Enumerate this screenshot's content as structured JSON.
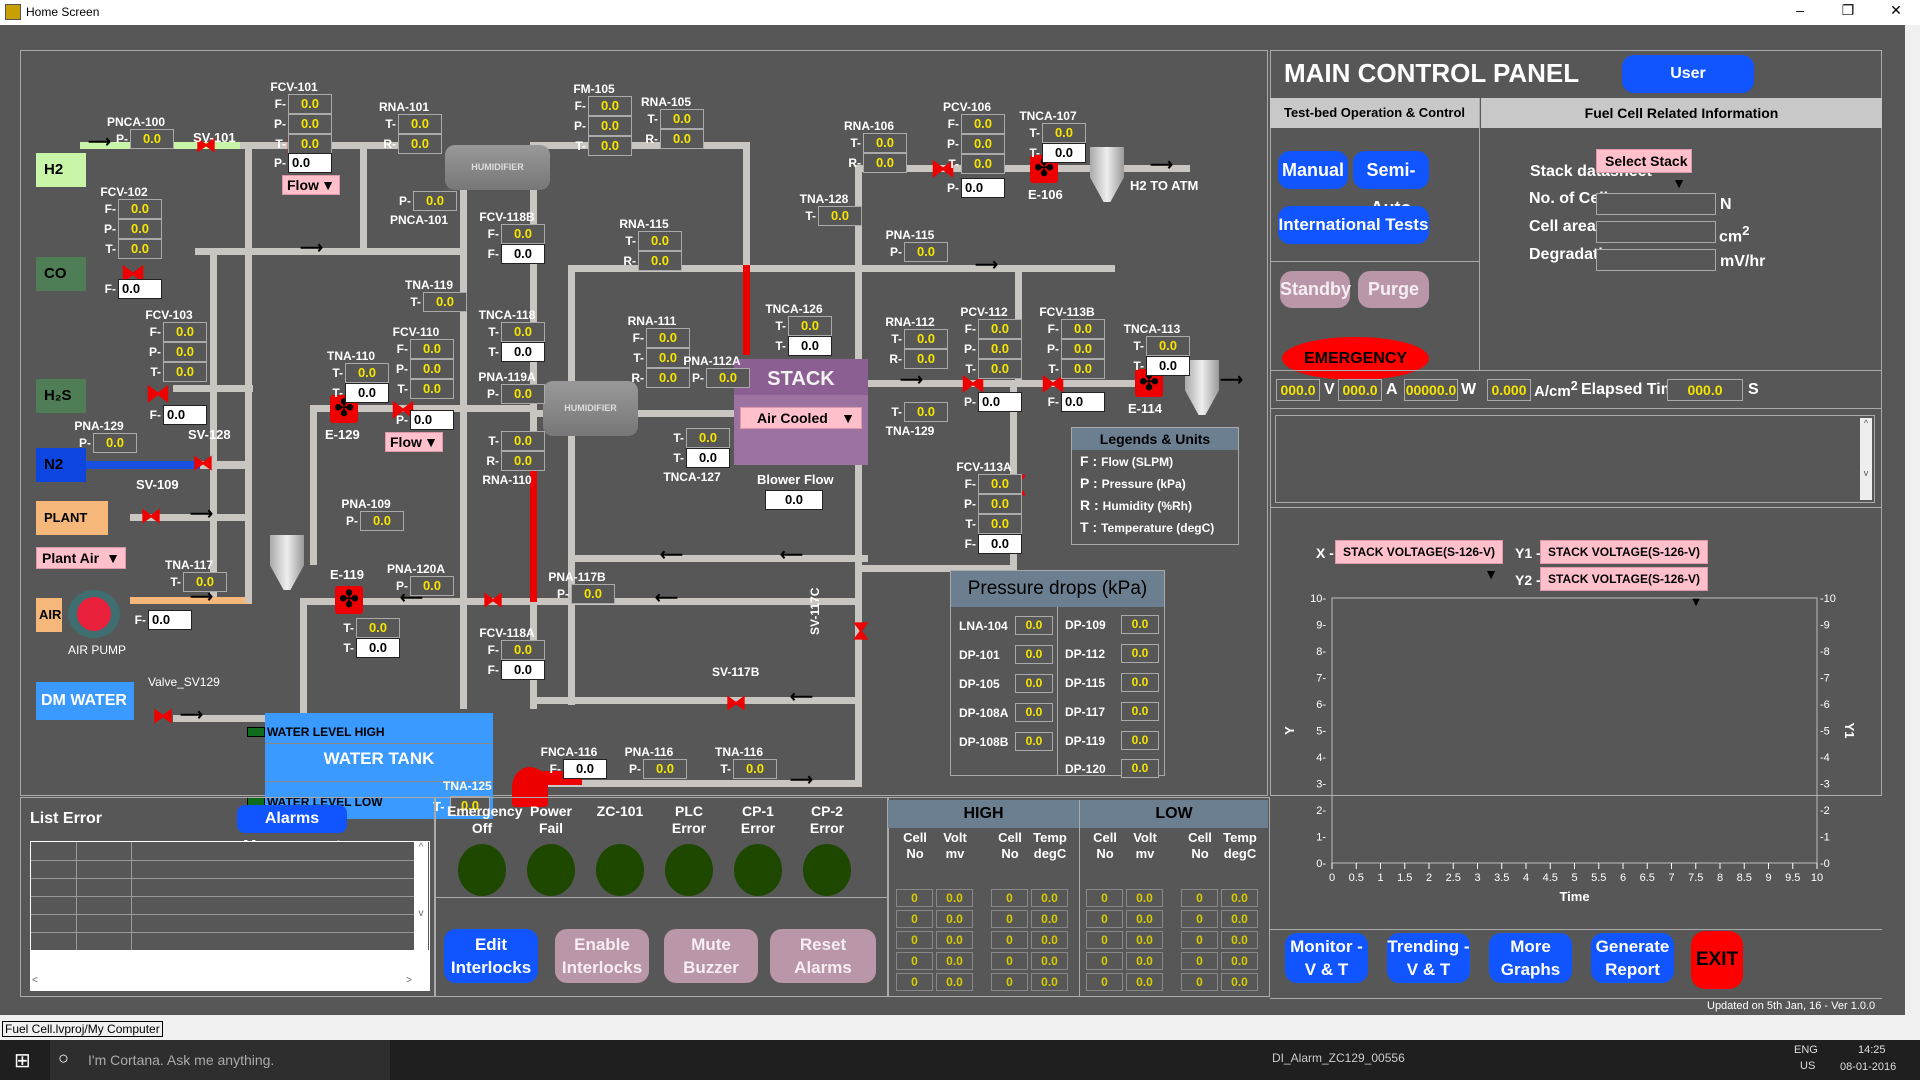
{
  "window": {
    "title": "Home Screen",
    "minimize": "–",
    "restore": "❐",
    "close": "✕"
  },
  "statusbar": {
    "path": "Fuel Cell.lvproj/My Computer"
  },
  "taskbar": {
    "search_placeholder": "I'm Cortana. Ask me anything.",
    "lang": "ENG",
    "region": "US",
    "time": "14:25",
    "date": "08-01-2016",
    "task_text": "DI_Alarm_ZC129_00556"
  },
  "sources": {
    "h2": "H2",
    "co": "CO",
    "h2s": "H₂S",
    "n2": "N2",
    "plant_air": "PLANT AIR",
    "air": "AIR",
    "air_pump": "AIR PUMP",
    "dm_water": "DM WATER",
    "plant_air_select": "Plant Air",
    "h2_to_atm": "H2  TO ATM"
  },
  "instruments": {
    "pnca100": {
      "name": "PNCA-100",
      "P": "0.0"
    },
    "sv101": "SV-101",
    "fcv101": {
      "name": "FCV-101",
      "F": "0.0",
      "P": "0.0",
      "T": "0.0",
      "P_set": "0.0",
      "mode": "Flow"
    },
    "rna101": {
      "name": "RNA-101",
      "T": "0.0",
      "R": "0.0"
    },
    "pnca101": {
      "name": "PNCA-101",
      "P": "0.0"
    },
    "fcv102": {
      "name": "FCV-102",
      "F": "0.0",
      "P": "0.0",
      "T": "0.0",
      "F_set": "0.0"
    },
    "fcv103": {
      "name": "FCV-103",
      "F": "0.0",
      "P": "0.0",
      "T": "0.0",
      "F_set": "0.0"
    },
    "pna129": {
      "name": "PNA-129",
      "P": "0.0"
    },
    "sv128": "SV-128",
    "sv109": "SV-109",
    "tna117": {
      "name": "TNA-117",
      "T": "0.0"
    },
    "air_f": {
      "F": "0.0"
    },
    "valve_sv129": "Valve_SV129",
    "fm105": {
      "name": "FM-105",
      "F": "0.0",
      "P": "0.0",
      "T": "0.0"
    },
    "rna105": {
      "name": "RNA-105",
      "T": "0.0",
      "R": "0.0"
    },
    "humidifier1": "HUMIDIFIER",
    "humidifier2": "HUMIDIFIER",
    "fcv118b": {
      "name": "FCV-118B",
      "F": "0.0",
      "F_set": "0.0"
    },
    "tna119": {
      "name": "TNA-119",
      "T": "0.0"
    },
    "tnca118": {
      "name": "TNCA-118",
      "T": "0.0",
      "T_set": "0.0"
    },
    "pna119a": {
      "name": "PNA-119A",
      "P": "0.0"
    },
    "rna110": {
      "name": "RNA-110",
      "T": "0.0",
      "R": "0.0"
    },
    "tna110": {
      "name": "TNA-110",
      "T": "0.0",
      "T_set": "0.0"
    },
    "e129": "E-129",
    "fcv110": {
      "name": "FCV-110",
      "F": "0.0",
      "P": "0.0",
      "T": "0.0",
      "P_set": "0.0",
      "mode": "Flow"
    },
    "pna109": {
      "name": "PNA-109",
      "P": "0.0"
    },
    "e119": {
      "name": "E-119",
      "T": "0.0",
      "T_set": "0.0"
    },
    "pna120a": {
      "name": "PNA-120A",
      "P": "0.0"
    },
    "fcv118a": {
      "name": "FCV-118A",
      "F": "0.0",
      "F_set": "0.0"
    },
    "rna115": {
      "name": "RNA-115",
      "T": "0.0",
      "R": "0.0"
    },
    "rna111": {
      "name": "RNA-111",
      "F": "0.0",
      "T": "0.0",
      "R": "0.0"
    },
    "pna112a": {
      "name": "PNA-112A",
      "P": "0.0"
    },
    "tnca127": {
      "name": "TNCA-127",
      "T": "0.0",
      "T_set": "0.0"
    },
    "tnca126": {
      "name": "TNCA-126",
      "T": "0.0",
      "T_set": "0.0"
    },
    "stack": {
      "title": "STACK",
      "cooling": "Air Cooled",
      "blower_label": "Blower Flow",
      "blower": "0.0"
    },
    "pna117b": {
      "name": "PNA-117B",
      "P": "0.0"
    },
    "rna106": {
      "name": "RNA-106",
      "T": "0.0",
      "R": "0.0"
    },
    "tna128": {
      "name": "TNA-128",
      "T": "0.0"
    },
    "pcv106": {
      "name": "PCV-106",
      "F": "0.0",
      "P": "0.0",
      "T": "0.0",
      "P_set": "0.0"
    },
    "tnca107": {
      "name": "TNCA-107",
      "T": "0.0",
      "T_set": "0.0"
    },
    "e106": "E-106",
    "pna115": {
      "name": "PNA-115",
      "P": "0.0"
    },
    "rna112": {
      "name": "RNA-112",
      "T": "0.0",
      "R": "0.0"
    },
    "tna129": {
      "name": "TNA-129",
      "T": "0.0"
    },
    "pcv112": {
      "name": "PCV-112",
      "F": "0.0",
      "P": "0.0",
      "T": "0.0",
      "P_set": "0.0"
    },
    "fcv113b": {
      "name": "FCV-113B",
      "F": "0.0",
      "P": "0.0",
      "T": "0.0",
      "F_set": "0.0"
    },
    "tnca113": {
      "name": "TNCA-113",
      "T": "0.0",
      "T_set": "0.0"
    },
    "e114": "E-114",
    "fcv113a": {
      "name": "FCV-113A",
      "F": "0.0",
      "P": "0.0",
      "T": "0.0",
      "F_set": "0.0"
    },
    "sv117c": "SV-117C",
    "sv117b": "SV-117B",
    "fnca116": {
      "name": "FNCA-116",
      "F": "0.0"
    },
    "pna116": {
      "name": "PNA-116",
      "P": "0.0"
    },
    "tna116": {
      "name": "TNA-116",
      "T": "0.0"
    },
    "tna125": {
      "name": "TNA-125",
      "T": "0.0"
    },
    "water_tank": {
      "title": "WATER  TANK",
      "level_high": "WATER LEVEL HIGH",
      "level_low": "WATER LEVEL LOW"
    }
  },
  "legend": {
    "title": "Legends & Units",
    "items": [
      {
        "key": "F :",
        "text": "Flow (SLPM)"
      },
      {
        "key": "P :",
        "text": "Pressure (kPa)"
      },
      {
        "key": "R :",
        "text": "Humidity (%Rh)"
      },
      {
        "key": "T :",
        "text": "Temperature (degC)"
      }
    ]
  },
  "pressure_drops": {
    "title": "Pressure drops (kPa)",
    "left": [
      {
        "name": "LNA-104",
        "value": "0.0"
      },
      {
        "name": "DP-101",
        "value": "0.0"
      },
      {
        "name": "DP-105",
        "value": "0.0"
      },
      {
        "name": "DP-108A",
        "value": "0.0"
      },
      {
        "name": "DP-108B",
        "value": "0.0"
      }
    ],
    "right": [
      {
        "name": "DP-109",
        "value": "0.0"
      },
      {
        "name": "DP-112",
        "value": "0.0"
      },
      {
        "name": "DP-115",
        "value": "0.0"
      },
      {
        "name": "DP-117",
        "value": "0.0"
      },
      {
        "name": "DP-119",
        "value": "0.0"
      },
      {
        "name": "DP-120",
        "value": "0.0"
      }
    ]
  },
  "control_panel": {
    "title": "MAIN CONTROL PANEL",
    "user_mgmt": "User Management",
    "testbed_header": "Test-bed Operation & Control",
    "info_header": "Fuel Cell Related Information",
    "manual": "Manual",
    "semi_auto": "Semi-Auto",
    "intl_tests": "International Tests",
    "standby": "Standby",
    "purge": "Purge",
    "emergency": "EMERGENCY",
    "stack_datasheet": "Stack datasheet",
    "select_stack": "Select Stack",
    "num_cells": "No. of Cells",
    "num_cells_unit": "N",
    "num_cells_value": "",
    "cell_area": "Cell area",
    "cell_area_unit": "cm",
    "cell_area_sup": "2",
    "cell_area_value": "",
    "degradation": "Degradation",
    "degradation_unit": "mV/hr",
    "degradation_value": ""
  },
  "readouts": {
    "volt": "000.0",
    "volt_unit": "V",
    "amp": "000.0",
    "amp_unit": "A",
    "watt": "00000.0",
    "watt_unit": "W",
    "density": "0.000",
    "density_unit": "A/cm",
    "density_sup": "2",
    "elapsed_label": "Elapsed Time",
    "elapsed": "000.0",
    "elapsed_unit": "S"
  },
  "message_box": {
    "text": ""
  },
  "graph_selectors": {
    "x_label": "X -",
    "x": "STACK VOLTAGE(S-126-V)",
    "y1_label": "Y1 -",
    "y1": "STACK VOLTAGE(S-126-V)",
    "y2_label": "Y2 -",
    "y2": "STACK VOLTAGE(S-126-V)"
  },
  "chart_data": {
    "type": "line",
    "title": "",
    "xlabel": "Time",
    "ylabel": "Y",
    "y2label": "Y1",
    "xlim": [
      0,
      10
    ],
    "ylim": [
      0,
      10
    ],
    "y2lim": [
      0,
      10
    ],
    "xticks": [
      "0",
      "0.5",
      "1",
      "1.5",
      "2",
      "2.5",
      "3",
      "3.5",
      "4",
      "4.5",
      "5",
      "5.5",
      "6",
      "6.5",
      "7",
      "7.5",
      "8",
      "8.5",
      "9",
      "9.5",
      "10"
    ],
    "yticks": [
      "0",
      "1",
      "2",
      "3",
      "4",
      "5",
      "6",
      "7",
      "8",
      "9",
      "10"
    ],
    "grid": false,
    "series": []
  },
  "bottom_buttons": {
    "monitor": [
      "Monitor -",
      "V & T"
    ],
    "trending": [
      "Trending -",
      "V & T"
    ],
    "more_graphs": [
      "More",
      "Graphs"
    ],
    "report": [
      "Generate",
      "Report"
    ],
    "exit": "EXIT"
  },
  "version": "Updated on 5th Jan, 16 - Ver 1.0.0",
  "errors": {
    "title": "List Error",
    "alarms_btn": "Alarms Management"
  },
  "status_leds": [
    {
      "label": [
        "Emergency",
        "Off"
      ],
      "on": false
    },
    {
      "label": [
        "Power",
        "Fail"
      ],
      "on": false
    },
    {
      "label": [
        "ZC-101",
        ""
      ],
      "on": false
    },
    {
      "label": [
        "PLC",
        "Error"
      ],
      "on": false
    },
    {
      "label": [
        "CP-1",
        "Error"
      ],
      "on": false
    },
    {
      "label": [
        "CP-2",
        "Error"
      ],
      "on": false
    }
  ],
  "interlock_buttons": {
    "edit": [
      "Edit",
      "Interlocks"
    ],
    "enable": [
      "Enable",
      "Interlocks"
    ],
    "mute": [
      "Mute",
      "Buzzer"
    ],
    "reset": [
      "Reset",
      "Alarms"
    ]
  },
  "cell_tables": {
    "high_title": "HIGH",
    "low_title": "LOW",
    "headers": [
      [
        "Cell",
        "No"
      ],
      [
        "Volt",
        "mv"
      ],
      [
        "Cell",
        "No"
      ],
      [
        "Temp",
        "degC"
      ]
    ],
    "high_rows": [
      [
        "0",
        "0.0",
        "0",
        "0.0"
      ],
      [
        "0",
        "0.0",
        "0",
        "0.0"
      ],
      [
        "0",
        "0.0",
        "0",
        "0.0"
      ],
      [
        "0",
        "0.0",
        "0",
        "0.0"
      ],
      [
        "0",
        "0.0",
        "0",
        "0.0"
      ]
    ],
    "low_rows": [
      [
        "0",
        "0.0",
        "0",
        "0.0"
      ],
      [
        "0",
        "0.0",
        "0",
        "0.0"
      ],
      [
        "0",
        "0.0",
        "0",
        "0.0"
      ],
      [
        "0",
        "0.0",
        "0",
        "0.0"
      ],
      [
        "0",
        "0.0",
        "0",
        "0.0"
      ]
    ]
  }
}
